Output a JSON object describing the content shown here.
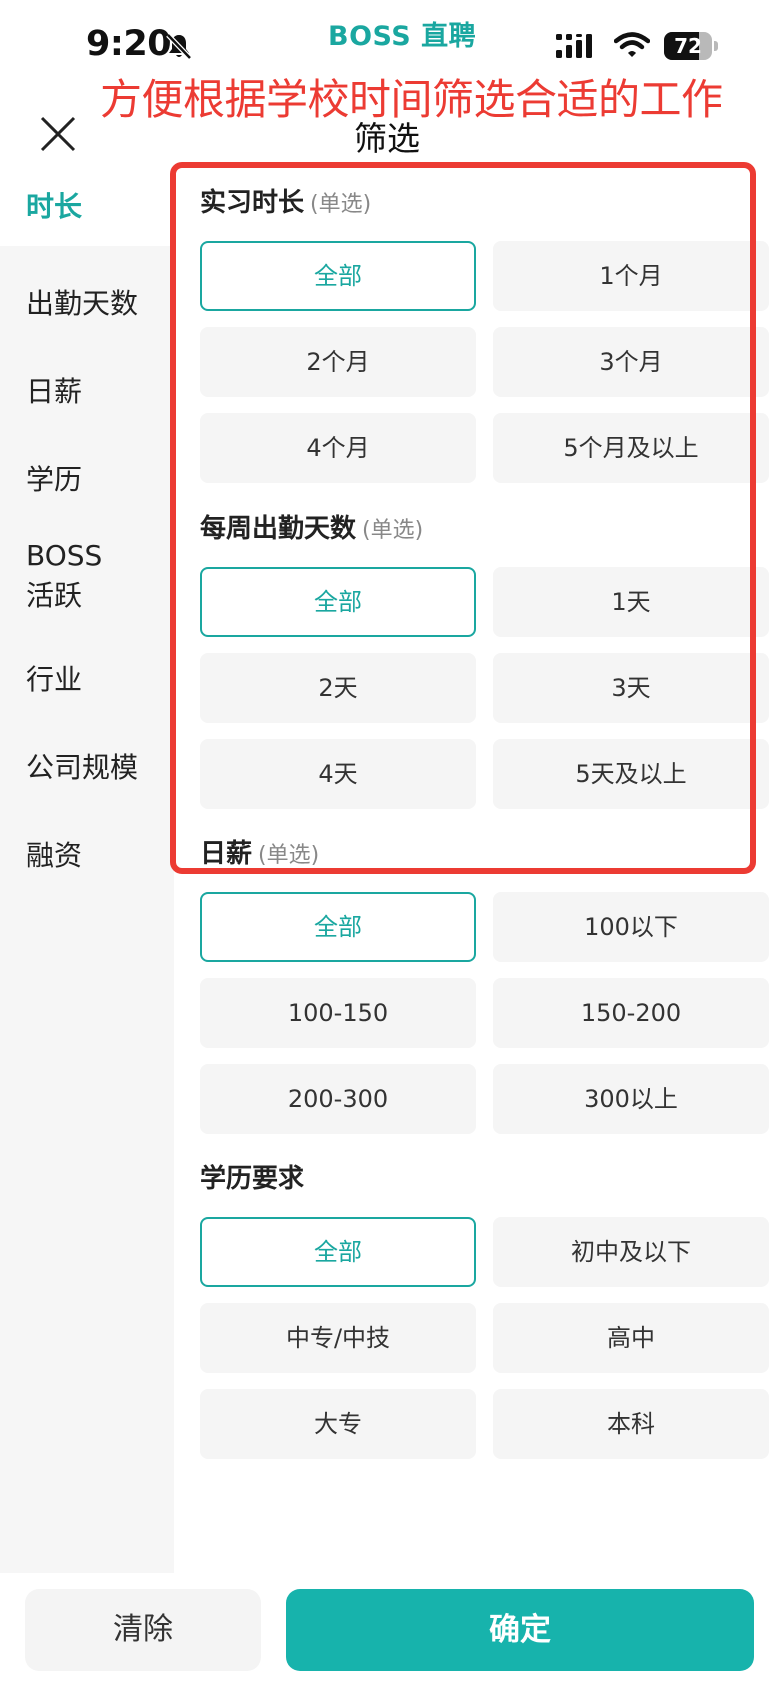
{
  "status_bar": {
    "time": "9:20",
    "brand": "BOSS 直聘",
    "battery": "72",
    "battery_level": 0.72
  },
  "annotation": "方便根据学校时间筛选合适的工作",
  "header": {
    "title": "筛选"
  },
  "sidebar": {
    "items": [
      {
        "label": "时长",
        "active": true
      },
      {
        "label": "出勤天数"
      },
      {
        "label": "日薪"
      },
      {
        "label": "学历"
      },
      {
        "label": "BOSS\n活跃"
      },
      {
        "label": "行业"
      },
      {
        "label": "公司规模"
      },
      {
        "label": "融资"
      }
    ]
  },
  "sections": [
    {
      "title": "实习时长",
      "note": "(单选)",
      "options": [
        "全部",
        "1个月",
        "2个月",
        "3个月",
        "4个月",
        "5个月及以上"
      ],
      "selected": 0
    },
    {
      "title": "每周出勤天数",
      "note": "(单选)",
      "options": [
        "全部",
        "1天",
        "2天",
        "3天",
        "4天",
        "5天及以上"
      ],
      "selected": 0
    },
    {
      "title": "日薪",
      "note": "(单选)",
      "options": [
        "全部",
        "100以下",
        "100-150",
        "150-200",
        "200-300",
        "300以上"
      ],
      "selected": 0
    },
    {
      "title": "学历要求",
      "note": "",
      "options": [
        "全部",
        "初中及以下",
        "中专/中技",
        "高中",
        "大专",
        "本科"
      ],
      "selected": 0
    }
  ],
  "footer": {
    "clear": "清除",
    "confirm": "确定"
  },
  "colors": {
    "accent": "#1aa7a0",
    "annotation": "#ec3b33"
  }
}
